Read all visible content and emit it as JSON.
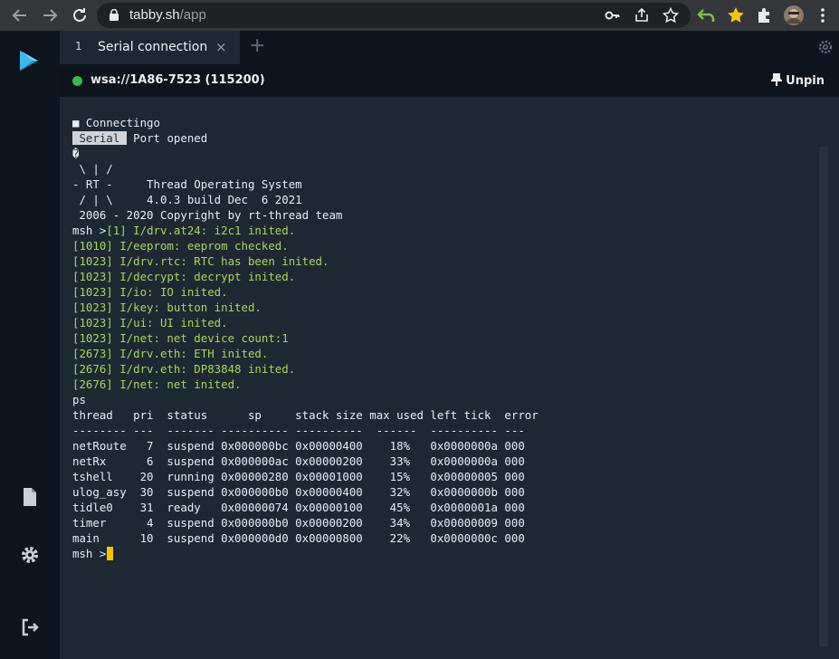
{
  "browser": {
    "url_host": "tabby.sh",
    "url_path": "/app",
    "icons": [
      "back-icon",
      "forward-icon",
      "reload-icon",
      "lock-icon",
      "key-icon",
      "share-icon",
      "star-icon",
      "undo-extension-icon",
      "favorite-extension-icon",
      "puzzle-icon",
      "profile-avatar",
      "menu-icon"
    ]
  },
  "tab": {
    "number": "1",
    "title": "Serial connection",
    "close": "×",
    "add": "+"
  },
  "connection": {
    "status_color": "#38b84d",
    "label": "wsa://1A86-7523 (115200)",
    "unpin_label": "Unpin"
  },
  "terminal": {
    "lines": [
      {
        "segments": [
          {
            "t": "■ Connectingo"
          }
        ]
      },
      {
        "segments": [
          {
            "t": " Serial ",
            "hl": true
          },
          {
            "t": " Port opened"
          }
        ]
      },
      {
        "segments": [
          {
            "t": "�"
          }
        ]
      },
      {
        "segments": [
          {
            "t": " \\ | /"
          }
        ]
      },
      {
        "segments": [
          {
            "t": "- RT -     Thread Operating System"
          }
        ]
      },
      {
        "segments": [
          {
            "t": " / | \\     4.0.3 build Dec  6 2021"
          }
        ]
      },
      {
        "segments": [
          {
            "t": " 2006 - 2020 Copyright by rt-thread team"
          }
        ]
      },
      {
        "segments": [
          {
            "t": "msh >"
          },
          {
            "t": "[1] I/drv.at24: i2c1 inited.",
            "g": true
          }
        ]
      },
      {
        "segments": [
          {
            "t": "[1010] I/eeprom: eeprom checked.",
            "g": true
          }
        ]
      },
      {
        "segments": [
          {
            "t": "[1023] I/drv.rtc: RTC has been inited.",
            "g": true
          }
        ]
      },
      {
        "segments": [
          {
            "t": "[1023] I/decrypt: decrypt inited.",
            "g": true
          }
        ]
      },
      {
        "segments": [
          {
            "t": "[1023] I/io: IO inited.",
            "g": true
          }
        ]
      },
      {
        "segments": [
          {
            "t": "[1023] I/key: button inited.",
            "g": true
          }
        ]
      },
      {
        "segments": [
          {
            "t": "[1023] I/ui: UI inited.",
            "g": true
          }
        ]
      },
      {
        "segments": [
          {
            "t": "[1023] I/net: net device count:1",
            "g": true
          }
        ]
      },
      {
        "segments": [
          {
            "t": "[2673] I/drv.eth: ETH inited.",
            "g": true
          }
        ]
      },
      {
        "segments": [
          {
            "t": "[2676] I/drv.eth: DP83848 inited.",
            "g": true
          }
        ]
      },
      {
        "segments": [
          {
            "t": "[2676] I/net: net inited.",
            "g": true
          }
        ]
      },
      {
        "segments": [
          {
            "t": "ps"
          }
        ]
      },
      {
        "segments": [
          {
            "t": "thread   pri  status      sp     stack size max used left tick  error"
          }
        ]
      },
      {
        "segments": [
          {
            "t": "-------- ---  ------- ---------- ----------  ------  ---------- ---"
          }
        ]
      },
      {
        "segments": [
          {
            "t": "netRoute   7  suspend 0x000000bc 0x00000400    18%   0x0000000a 000"
          }
        ]
      },
      {
        "segments": [
          {
            "t": "netRx      6  suspend 0x000000ac 0x00000200    33%   0x0000000a 000"
          }
        ]
      },
      {
        "segments": [
          {
            "t": "tshell    20  running 0x00000280 0x00001000    15%   0x00000005 000"
          }
        ]
      },
      {
        "segments": [
          {
            "t": "ulog_asy  30  suspend 0x000000b0 0x00000400    32%   0x0000000b 000"
          }
        ]
      },
      {
        "segments": [
          {
            "t": "tidle0    31  ready   0x00000074 0x00000100    45%   0x0000001a 000"
          }
        ]
      },
      {
        "segments": [
          {
            "t": "timer      4  suspend 0x000000b0 0x00000200    34%   0x00000009 000"
          }
        ]
      },
      {
        "segments": [
          {
            "t": "main      10  suspend 0x000000d0 0x00000800    22%   0x0000000c 000"
          }
        ]
      },
      {
        "segments": [
          {
            "t": "msh >"
          }
        ],
        "cursor": true
      }
    ]
  }
}
